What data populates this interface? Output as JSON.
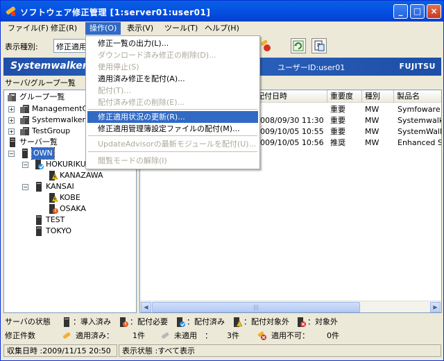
{
  "window": {
    "title": "ソフトウェア修正管理 [1:server01:user01]",
    "min": "_",
    "max": "□",
    "close": "×"
  },
  "menubar": [
    {
      "label": "ファイル(F)"
    },
    {
      "label": "修正(R)"
    },
    {
      "label": "操作(O)"
    },
    {
      "label": "表示(V)"
    },
    {
      "label": "ツール(T)"
    },
    {
      "label": "ヘルプ(H)"
    }
  ],
  "toolbar": {
    "kind_label": "表示種別:",
    "kind_value": "修正適用"
  },
  "banner": {
    "logo": "Systemwalker",
    "user": "ユーザーID:user01",
    "vendor": "FUJITSU"
  },
  "left_pane": {
    "header": "サーバ/グループ一覧"
  },
  "tree": [
    {
      "label": "グループ一覧"
    },
    {
      "label": "ManagementGroup"
    },
    {
      "label": "SystemwalkerGroup"
    },
    {
      "label": "TestGroup"
    },
    {
      "label": "サーバ一覧"
    },
    {
      "label": "OWN"
    },
    {
      "label": "HOKURIKU"
    },
    {
      "label": "KANAZAWA"
    },
    {
      "label": "KANSAI"
    },
    {
      "label": "KOBE"
    },
    {
      "label": "OSAKA"
    },
    {
      "label": "TEST"
    },
    {
      "label": "TOKYO"
    }
  ],
  "list": {
    "columns": [
      "配付日時",
      "重要度",
      "種別",
      "製品名"
    ],
    "rows": [
      [
        "",
        "重要",
        "MW",
        "Symfoware"
      ],
      [
        "2008/09/30 11:30",
        "重要",
        "MW",
        "Systemwalker"
      ],
      [
        "2009/10/05 10:55",
        "重要",
        "MW",
        "SystemWalker"
      ],
      [
        "2009/10/05 10:56",
        "推奨",
        "MW",
        "Enhanced S"
      ]
    ]
  },
  "dropdown": [
    {
      "label": "修正一覧の出力(L)...",
      "disabled": false
    },
    {
      "label": "ダウンロード済み修正の削除(D)...",
      "disabled": true
    },
    {
      "label": "使用停止(S)",
      "disabled": true
    },
    {
      "label": "適用済み修正を配付(A)...",
      "disabled": false
    },
    {
      "label": "配付(T)...",
      "disabled": true
    },
    {
      "label": "配付済み修正の削除(E)...",
      "disabled": true
    },
    {
      "label": "修正適用状況の更新(R)...",
      "disabled": false
    },
    {
      "label": "修正適用管理簿設定ファイルの配付(M)...",
      "disabled": false
    },
    {
      "label": "UpdateAdvisorの最新モジュールを配付(U)...",
      "disabled": true
    },
    {
      "label": "閲覧モードの解除(I)",
      "disabled": true
    }
  ],
  "status": {
    "server_state_label": "サーバの状態",
    "legend": [
      "：導入済み",
      "：配付必要",
      "：配付済み",
      "：配付対象外",
      "：対象外"
    ],
    "count_label": "修正件数",
    "applied_label": "適用済み：",
    "applied_count": "1件",
    "unapplied_label": "未適用　：",
    "unapplied_count": "3件",
    "na_label": "適用不可：",
    "na_count": "0件"
  },
  "statusbar": {
    "collected": "収集日時 :2009/11/15 20:50",
    "view": "表示状態 :すべて表示"
  },
  "colors": {
    "accent": "#316ac5",
    "titlebar": "#0554e3",
    "banner": "#2d65c2"
  }
}
